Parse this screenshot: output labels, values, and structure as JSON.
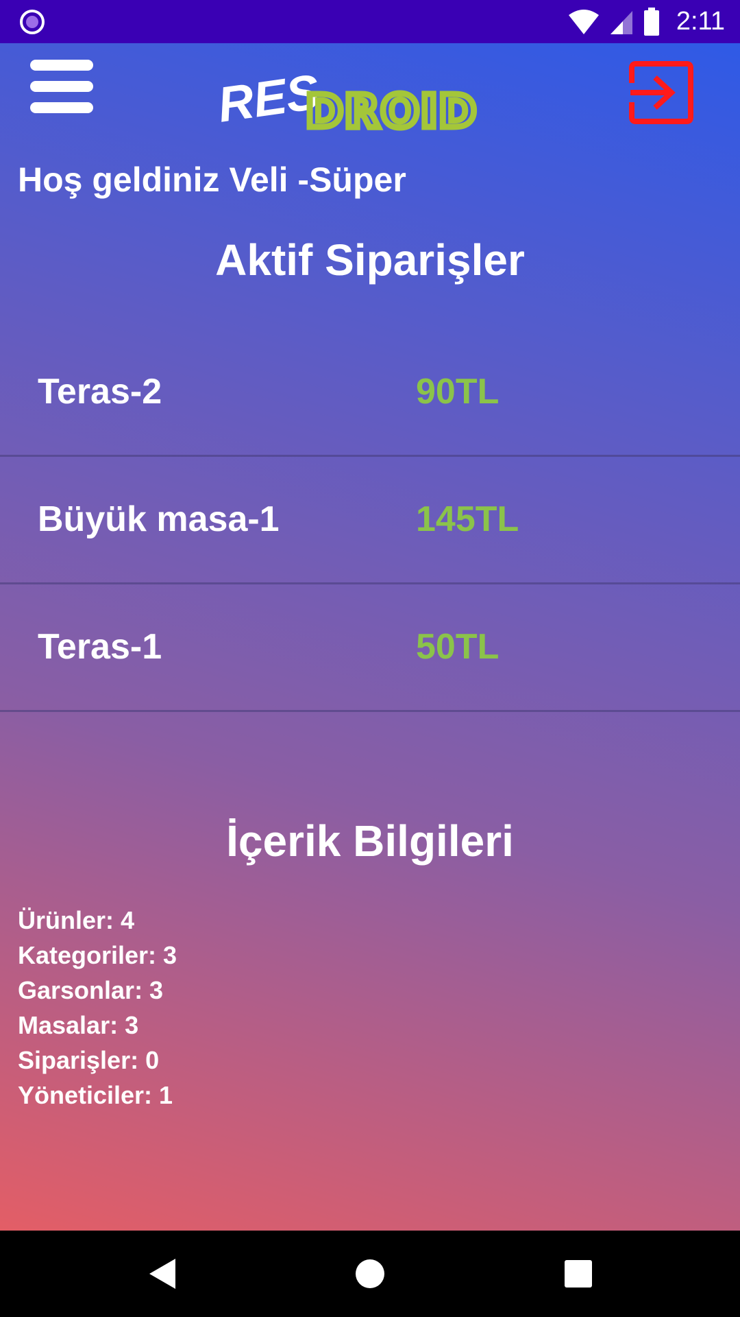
{
  "status_bar": {
    "time": "2:11"
  },
  "toolbar": {
    "logo_primary": "RES",
    "logo_secondary": "DROID"
  },
  "welcome_text": "Hoş geldiniz Veli -Süper",
  "active_orders": {
    "title": "Aktif Siparişler",
    "items": [
      {
        "name": "Teras-2",
        "price": "90TL"
      },
      {
        "name": "Büyük masa-1",
        "price": "145TL"
      },
      {
        "name": "Teras-1",
        "price": "50TL"
      }
    ]
  },
  "content_info": {
    "title": "İçerik Bilgileri",
    "lines": [
      "Ürünler: 4",
      "Kategoriler: 3",
      "Garsonlar: 3",
      "Masalar: 3",
      "Siparişler: 0",
      "Yöneticiler: 1"
    ]
  },
  "colors": {
    "status_bar": "#3a00b4",
    "price_green": "#8bc34a",
    "logout_red": "#ff1a1a",
    "logo_green": "#a4c639"
  }
}
